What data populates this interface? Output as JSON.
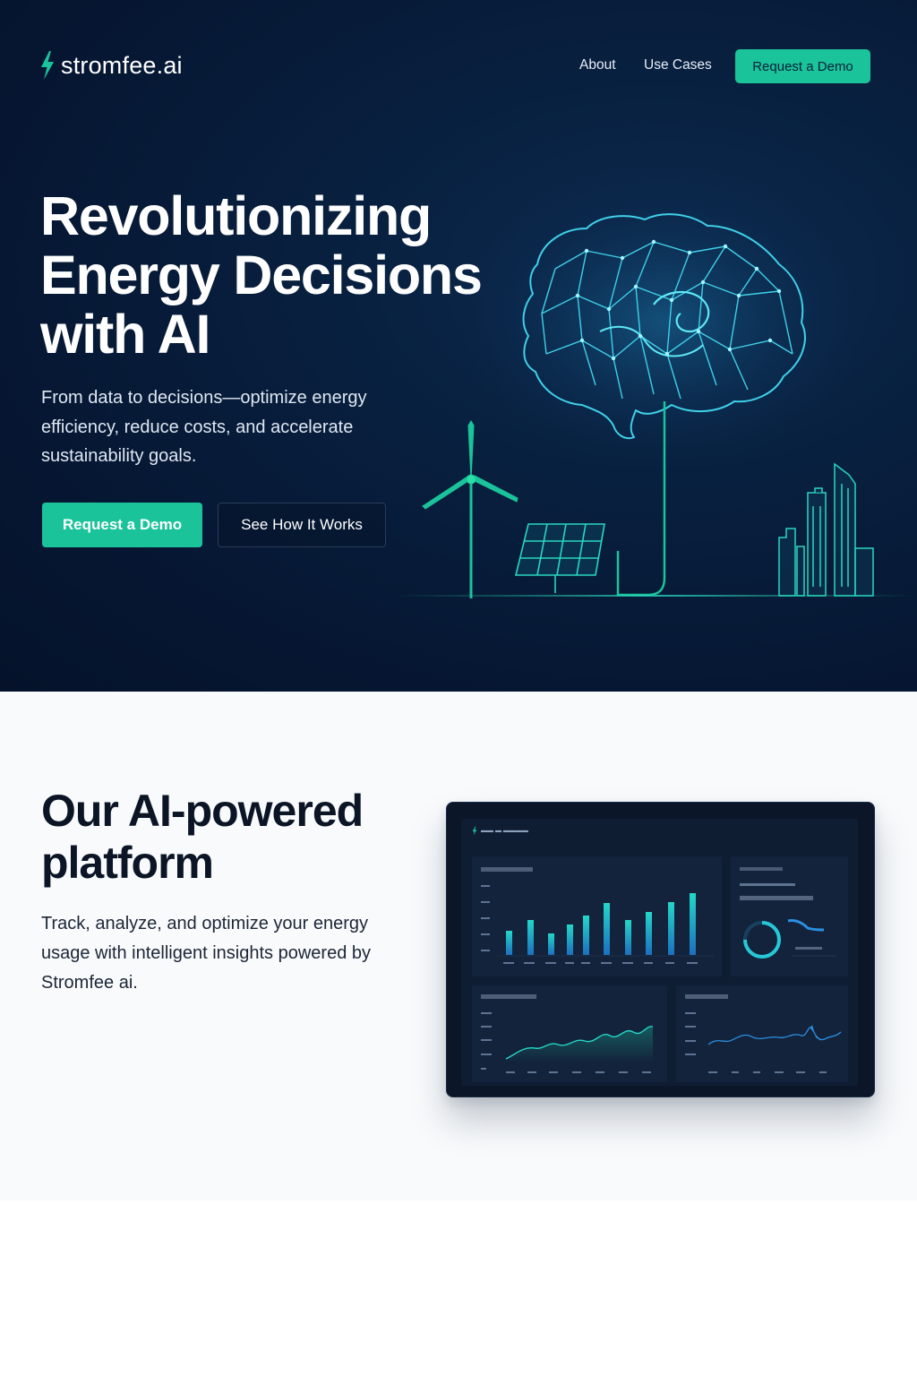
{
  "nav": {
    "logo_text": "stromfee.ai",
    "links": [
      "About",
      "Use Cases"
    ],
    "cta": "Request a Demo"
  },
  "hero": {
    "title": "Revolutionizing Energy Decisions with AI",
    "subtitle": "From data to decisions—optimize energy efficiency, reduce costs, and accelerate sustainability goals.",
    "primary_button": "Request a Demo",
    "secondary_button": "See How It Works"
  },
  "platform": {
    "title": "Our AI-powered platform",
    "description": "Track, analyze, and optimize your energy usage with intelligent insights powered by Stromfee ai."
  },
  "colors": {
    "accent": "#1bc39a",
    "hero_bg": "#061733",
    "section_bg": "#f8fafc"
  },
  "icons": [
    "lightning-bolt-icon",
    "brain-network-icon",
    "wind-turbine-icon",
    "solar-panel-icon",
    "city-skyline-icon"
  ]
}
